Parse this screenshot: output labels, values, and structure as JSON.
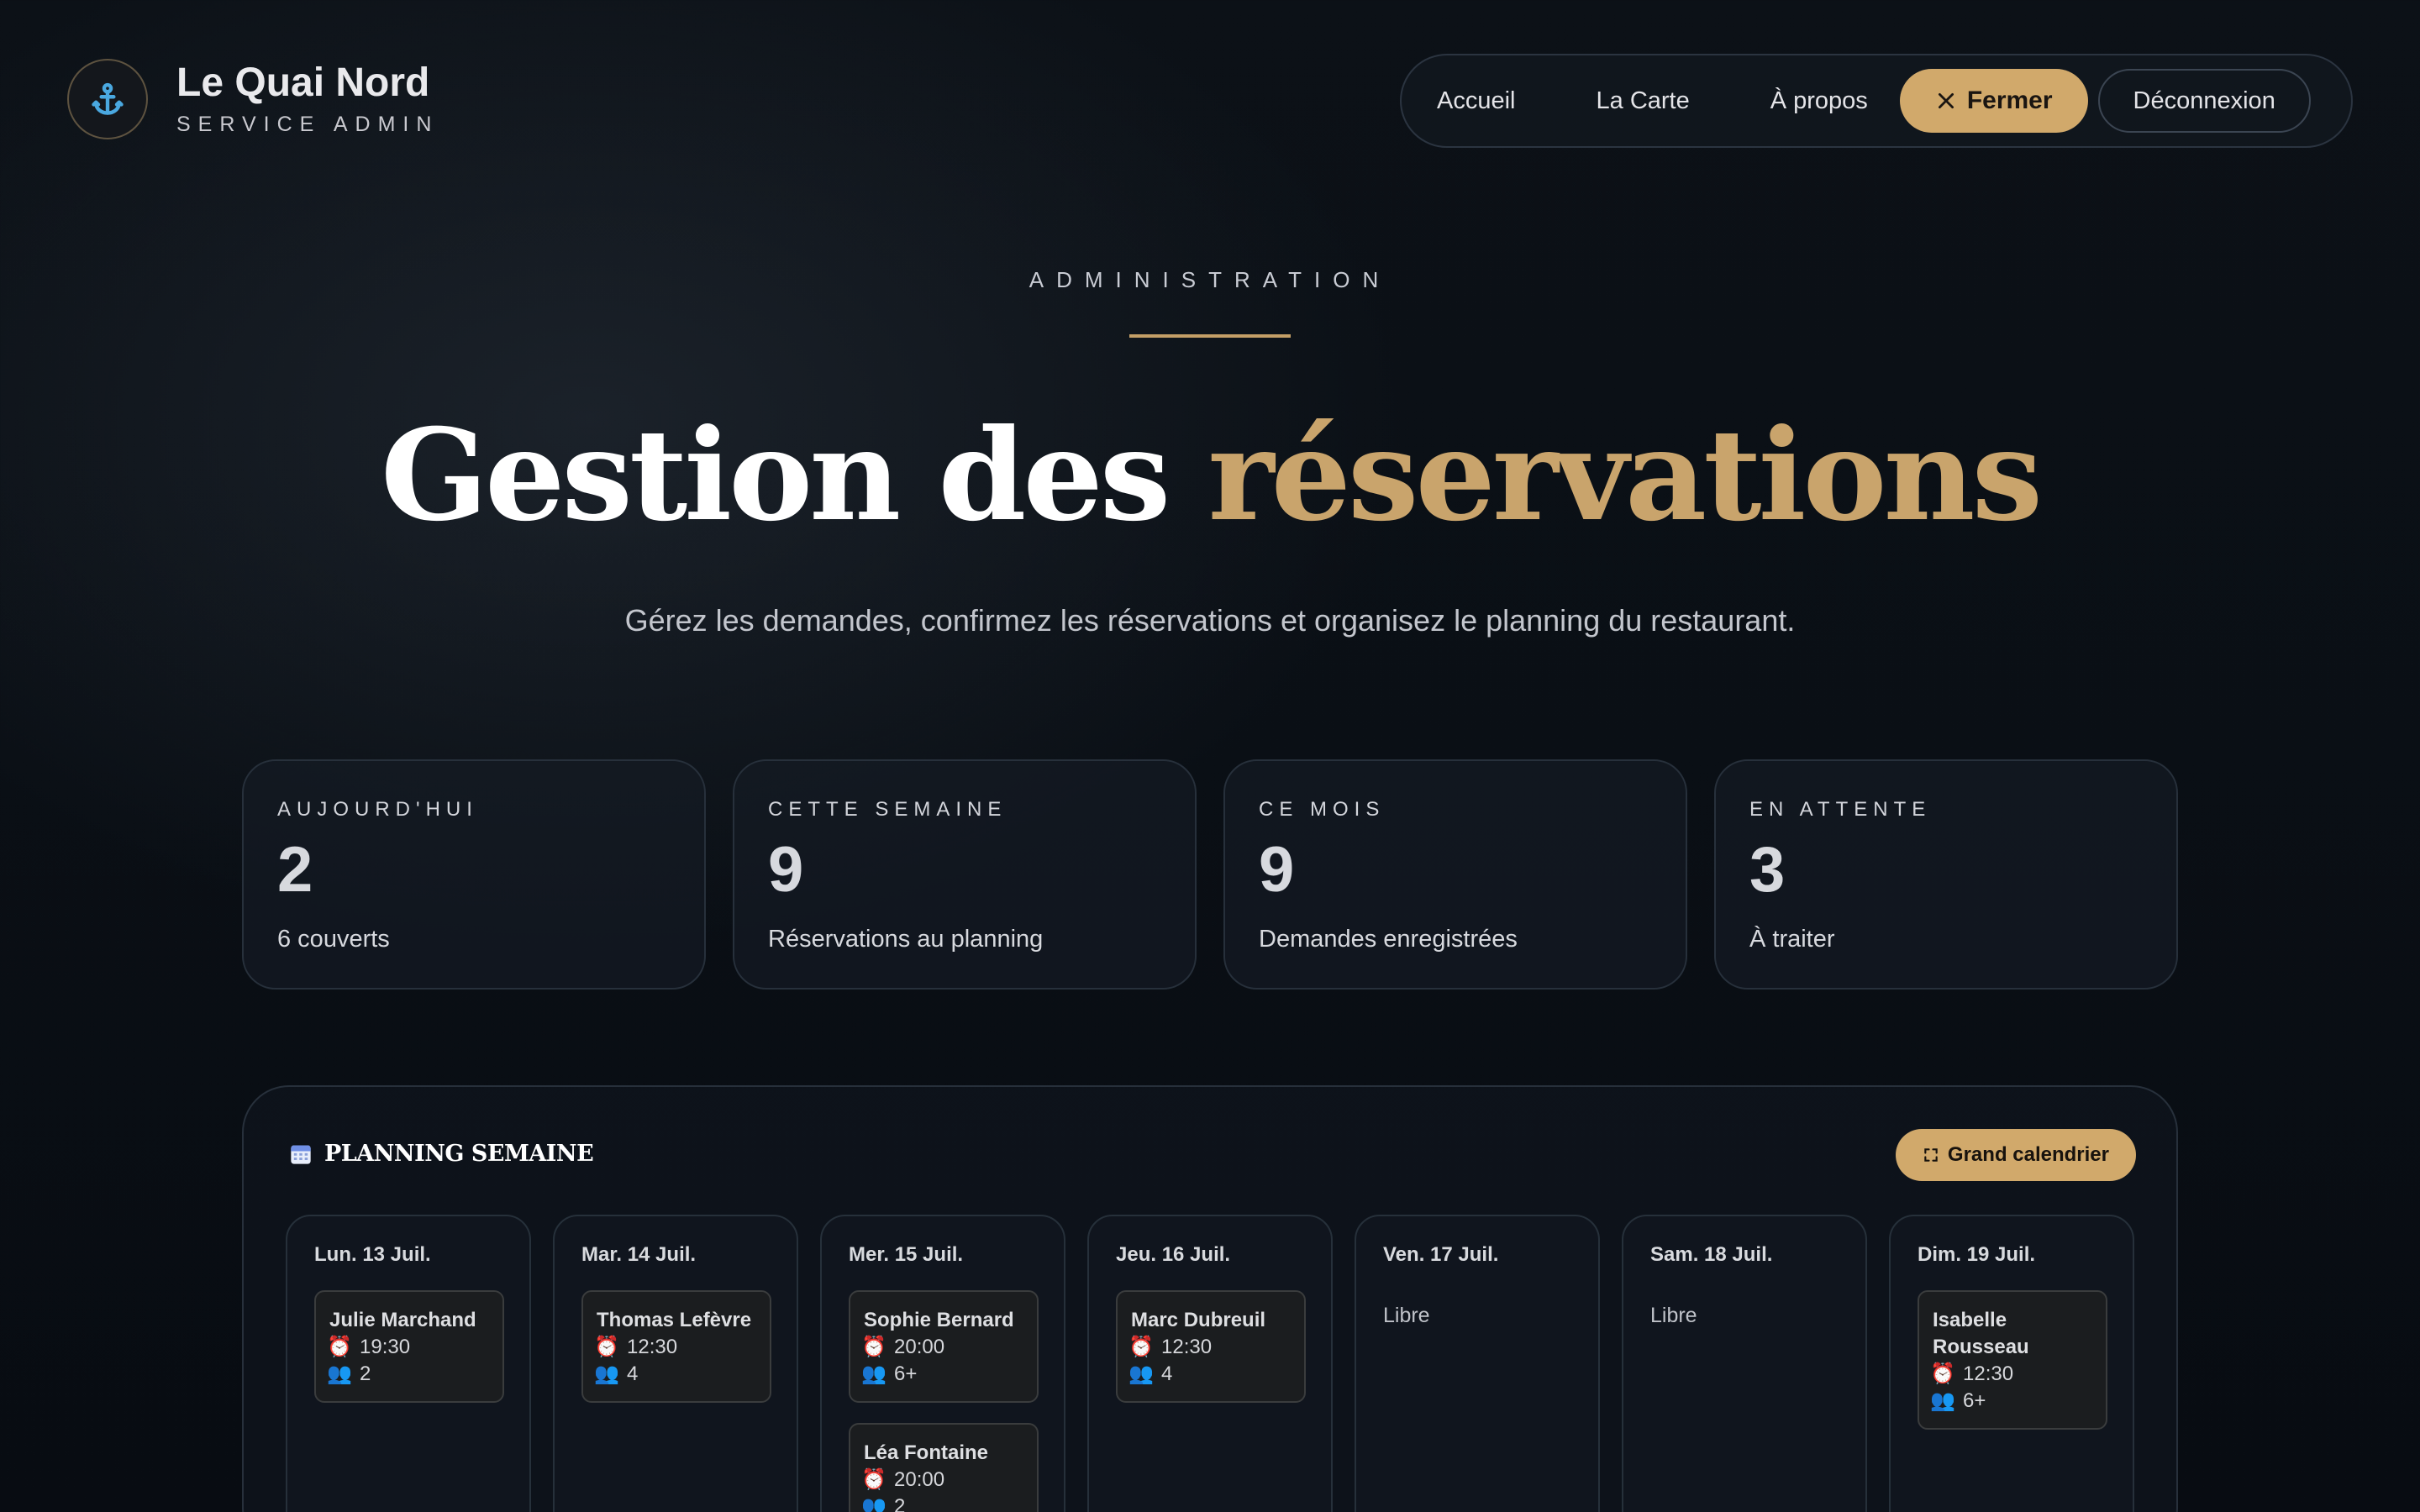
{
  "brand": {
    "name": "Le Quai Nord",
    "subtitle": "SERVICE ADMIN",
    "logo_icon": "anchor-icon"
  },
  "nav": {
    "links": [
      "Accueil",
      "La Carte",
      "À propos"
    ],
    "close_label": "Fermer",
    "logout_label": "Déconnexion"
  },
  "hero": {
    "kicker": "ADMINISTRATION",
    "title_part1": "Gestion des ",
    "title_accent": "réservations",
    "subtitle": "Gérez les demandes, confirmez les réservations et organisez le planning du restaurant."
  },
  "stats": [
    {
      "label": "AUJOURD'HUI",
      "value": "2",
      "desc": "6 couverts"
    },
    {
      "label": "CETTE SEMAINE",
      "value": "9",
      "desc": "Réservations au planning"
    },
    {
      "label": "CE MOIS",
      "value": "9",
      "desc": "Demandes enregistrées"
    },
    {
      "label": "EN ATTENTE",
      "value": "3",
      "desc": "À traiter"
    }
  ],
  "planning": {
    "title": "PLANNING SEMAINE",
    "title_icon": "calendar-icon",
    "big_calendar_label": "Grand calendrier",
    "days": [
      {
        "name": "Lun. 13 Juil.",
        "free_label": "",
        "reservations": [
          {
            "name": "Julie Marchand",
            "time": "19:30",
            "guests": "2"
          }
        ]
      },
      {
        "name": "Mar. 14 Juil.",
        "free_label": "",
        "reservations": [
          {
            "name": "Thomas Lefèvre",
            "time": "12:30",
            "guests": "4"
          }
        ]
      },
      {
        "name": "Mer. 15 Juil.",
        "free_label": "",
        "reservations": [
          {
            "name": "Sophie Bernard",
            "time": "20:00",
            "guests": "6+"
          },
          {
            "name": "Léa Fontaine",
            "time": "20:00",
            "guests": "2"
          }
        ]
      },
      {
        "name": "Jeu. 16 Juil.",
        "free_label": "",
        "reservations": [
          {
            "name": "Marc Dubreuil",
            "time": "12:30",
            "guests": "4"
          }
        ]
      },
      {
        "name": "Ven. 17 Juil.",
        "free_label": "Libre",
        "reservations": []
      },
      {
        "name": "Sam. 18 Juil.",
        "free_label": "Libre",
        "reservations": []
      },
      {
        "name": "Dim. 19 Juil.",
        "free_label": "",
        "reservations": [
          {
            "name": "Isabelle Rousseau",
            "time": "12:30",
            "guests": "6+"
          }
        ]
      }
    ]
  },
  "colors": {
    "accent": "#d1a96b",
    "background": "#0a0f15",
    "title_accent": "#c9a46c"
  }
}
